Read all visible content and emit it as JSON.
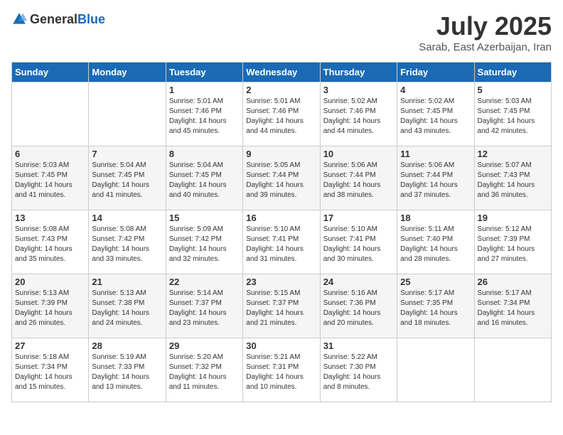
{
  "logo": {
    "text1": "General",
    "text2": "Blue"
  },
  "title": "July 2025",
  "location": "Sarab, East Azerbaijan, Iran",
  "weekdays": [
    "Sunday",
    "Monday",
    "Tuesday",
    "Wednesday",
    "Thursday",
    "Friday",
    "Saturday"
  ],
  "weeks": [
    [
      {
        "day": "",
        "sunrise": "",
        "sunset": "",
        "daylight": ""
      },
      {
        "day": "",
        "sunrise": "",
        "sunset": "",
        "daylight": ""
      },
      {
        "day": "1",
        "sunrise": "Sunrise: 5:01 AM",
        "sunset": "Sunset: 7:46 PM",
        "daylight": "Daylight: 14 hours and 45 minutes."
      },
      {
        "day": "2",
        "sunrise": "Sunrise: 5:01 AM",
        "sunset": "Sunset: 7:46 PM",
        "daylight": "Daylight: 14 hours and 44 minutes."
      },
      {
        "day": "3",
        "sunrise": "Sunrise: 5:02 AM",
        "sunset": "Sunset: 7:46 PM",
        "daylight": "Daylight: 14 hours and 44 minutes."
      },
      {
        "day": "4",
        "sunrise": "Sunrise: 5:02 AM",
        "sunset": "Sunset: 7:45 PM",
        "daylight": "Daylight: 14 hours and 43 minutes."
      },
      {
        "day": "5",
        "sunrise": "Sunrise: 5:03 AM",
        "sunset": "Sunset: 7:45 PM",
        "daylight": "Daylight: 14 hours and 42 minutes."
      }
    ],
    [
      {
        "day": "6",
        "sunrise": "Sunrise: 5:03 AM",
        "sunset": "Sunset: 7:45 PM",
        "daylight": "Daylight: 14 hours and 41 minutes."
      },
      {
        "day": "7",
        "sunrise": "Sunrise: 5:04 AM",
        "sunset": "Sunset: 7:45 PM",
        "daylight": "Daylight: 14 hours and 41 minutes."
      },
      {
        "day": "8",
        "sunrise": "Sunrise: 5:04 AM",
        "sunset": "Sunset: 7:45 PM",
        "daylight": "Daylight: 14 hours and 40 minutes."
      },
      {
        "day": "9",
        "sunrise": "Sunrise: 5:05 AM",
        "sunset": "Sunset: 7:44 PM",
        "daylight": "Daylight: 14 hours and 39 minutes."
      },
      {
        "day": "10",
        "sunrise": "Sunrise: 5:06 AM",
        "sunset": "Sunset: 7:44 PM",
        "daylight": "Daylight: 14 hours and 38 minutes."
      },
      {
        "day": "11",
        "sunrise": "Sunrise: 5:06 AM",
        "sunset": "Sunset: 7:44 PM",
        "daylight": "Daylight: 14 hours and 37 minutes."
      },
      {
        "day": "12",
        "sunrise": "Sunrise: 5:07 AM",
        "sunset": "Sunset: 7:43 PM",
        "daylight": "Daylight: 14 hours and 36 minutes."
      }
    ],
    [
      {
        "day": "13",
        "sunrise": "Sunrise: 5:08 AM",
        "sunset": "Sunset: 7:43 PM",
        "daylight": "Daylight: 14 hours and 35 minutes."
      },
      {
        "day": "14",
        "sunrise": "Sunrise: 5:08 AM",
        "sunset": "Sunset: 7:42 PM",
        "daylight": "Daylight: 14 hours and 33 minutes."
      },
      {
        "day": "15",
        "sunrise": "Sunrise: 5:09 AM",
        "sunset": "Sunset: 7:42 PM",
        "daylight": "Daylight: 14 hours and 32 minutes."
      },
      {
        "day": "16",
        "sunrise": "Sunrise: 5:10 AM",
        "sunset": "Sunset: 7:41 PM",
        "daylight": "Daylight: 14 hours and 31 minutes."
      },
      {
        "day": "17",
        "sunrise": "Sunrise: 5:10 AM",
        "sunset": "Sunset: 7:41 PM",
        "daylight": "Daylight: 14 hours and 30 minutes."
      },
      {
        "day": "18",
        "sunrise": "Sunrise: 5:11 AM",
        "sunset": "Sunset: 7:40 PM",
        "daylight": "Daylight: 14 hours and 28 minutes."
      },
      {
        "day": "19",
        "sunrise": "Sunrise: 5:12 AM",
        "sunset": "Sunset: 7:39 PM",
        "daylight": "Daylight: 14 hours and 27 minutes."
      }
    ],
    [
      {
        "day": "20",
        "sunrise": "Sunrise: 5:13 AM",
        "sunset": "Sunset: 7:39 PM",
        "daylight": "Daylight: 14 hours and 26 minutes."
      },
      {
        "day": "21",
        "sunrise": "Sunrise: 5:13 AM",
        "sunset": "Sunset: 7:38 PM",
        "daylight": "Daylight: 14 hours and 24 minutes."
      },
      {
        "day": "22",
        "sunrise": "Sunrise: 5:14 AM",
        "sunset": "Sunset: 7:37 PM",
        "daylight": "Daylight: 14 hours and 23 minutes."
      },
      {
        "day": "23",
        "sunrise": "Sunrise: 5:15 AM",
        "sunset": "Sunset: 7:37 PM",
        "daylight": "Daylight: 14 hours and 21 minutes."
      },
      {
        "day": "24",
        "sunrise": "Sunrise: 5:16 AM",
        "sunset": "Sunset: 7:36 PM",
        "daylight": "Daylight: 14 hours and 20 minutes."
      },
      {
        "day": "25",
        "sunrise": "Sunrise: 5:17 AM",
        "sunset": "Sunset: 7:35 PM",
        "daylight": "Daylight: 14 hours and 18 minutes."
      },
      {
        "day": "26",
        "sunrise": "Sunrise: 5:17 AM",
        "sunset": "Sunset: 7:34 PM",
        "daylight": "Daylight: 14 hours and 16 minutes."
      }
    ],
    [
      {
        "day": "27",
        "sunrise": "Sunrise: 5:18 AM",
        "sunset": "Sunset: 7:34 PM",
        "daylight": "Daylight: 14 hours and 15 minutes."
      },
      {
        "day": "28",
        "sunrise": "Sunrise: 5:19 AM",
        "sunset": "Sunset: 7:33 PM",
        "daylight": "Daylight: 14 hours and 13 minutes."
      },
      {
        "day": "29",
        "sunrise": "Sunrise: 5:20 AM",
        "sunset": "Sunset: 7:32 PM",
        "daylight": "Daylight: 14 hours and 11 minutes."
      },
      {
        "day": "30",
        "sunrise": "Sunrise: 5:21 AM",
        "sunset": "Sunset: 7:31 PM",
        "daylight": "Daylight: 14 hours and 10 minutes."
      },
      {
        "day": "31",
        "sunrise": "Sunrise: 5:22 AM",
        "sunset": "Sunset: 7:30 PM",
        "daylight": "Daylight: 14 hours and 8 minutes."
      },
      {
        "day": "",
        "sunrise": "",
        "sunset": "",
        "daylight": ""
      },
      {
        "day": "",
        "sunrise": "",
        "sunset": "",
        "daylight": ""
      }
    ]
  ]
}
